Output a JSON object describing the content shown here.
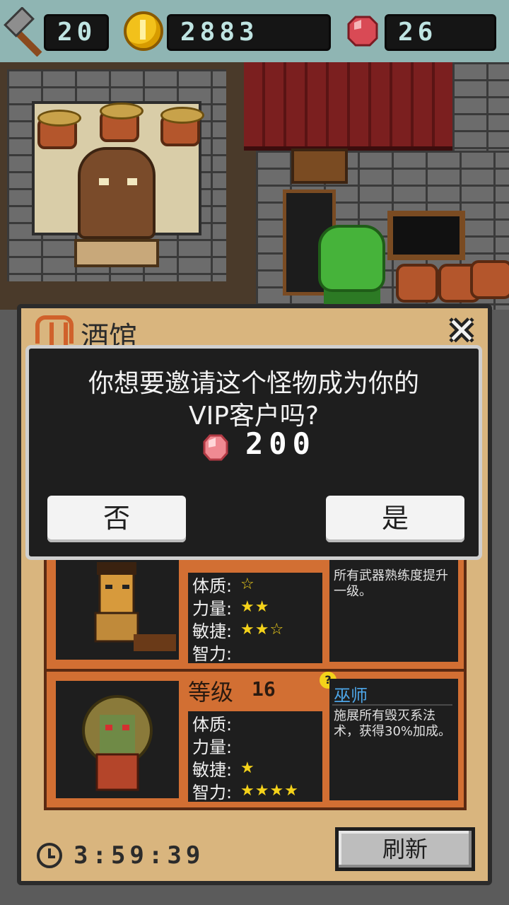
{
  "resources": {
    "hammers": "20",
    "gold": "2883",
    "gems": "26"
  },
  "panel": {
    "title": "酒馆",
    "timer": "3:59:39",
    "refresh_label": "刷新"
  },
  "monsters": [
    {
      "stats": [
        {
          "label": "体质:",
          "stars": "☆"
        },
        {
          "label": "力量:",
          "stars": "★★"
        },
        {
          "label": "敏捷:",
          "stars": "★★☆"
        },
        {
          "label": "智力:",
          "stars": ""
        }
      ],
      "skill_desc": "所有武器熟练度提升一级。"
    },
    {
      "level_label": "等级",
      "level": "16",
      "stats": [
        {
          "label": "体质:",
          "stars": ""
        },
        {
          "label": "力量:",
          "stars": ""
        },
        {
          "label": "敏捷:",
          "stars": "★"
        },
        {
          "label": "智力:",
          "stars": "★★★★"
        }
      ],
      "skill_name": "巫师",
      "skill_desc": "施展所有毁灭系法术，获得30%加成。"
    }
  ],
  "dialog": {
    "question_line1": "你想要邀请这个怪物成为你的",
    "question_line2": "VIP客户吗?",
    "cost": "200",
    "no_label": "否",
    "yes_label": "是"
  },
  "colors": {
    "accent_orange": "#d26f33",
    "panel_bg": "#d9b57e",
    "star": "#f4d21a",
    "skill_blue": "#4da6e8"
  }
}
